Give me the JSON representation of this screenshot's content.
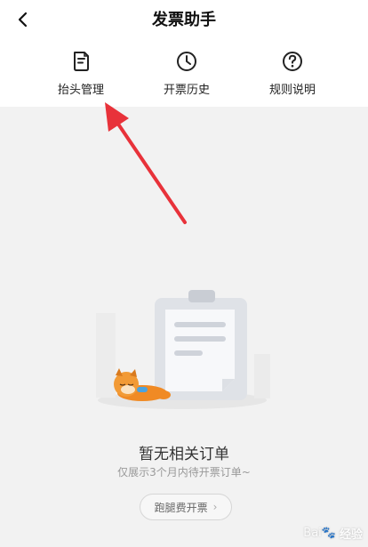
{
  "header": {
    "title": "发票助手"
  },
  "tools": [
    {
      "label": "抬头管理",
      "icon": "document-icon"
    },
    {
      "label": "开票历史",
      "icon": "clock-icon"
    },
    {
      "label": "规则说明",
      "icon": "question-icon"
    }
  ],
  "empty": {
    "title": "暂无相关订单",
    "subtitle": "仅展示3个月内待开票订单~",
    "action_label": "跑腿费开票"
  },
  "watermark": {
    "text": "Bai",
    "suffix": "经验"
  },
  "colors": {
    "annotation_arrow": "#e8323a",
    "page_bg": "#f2f2f2"
  }
}
